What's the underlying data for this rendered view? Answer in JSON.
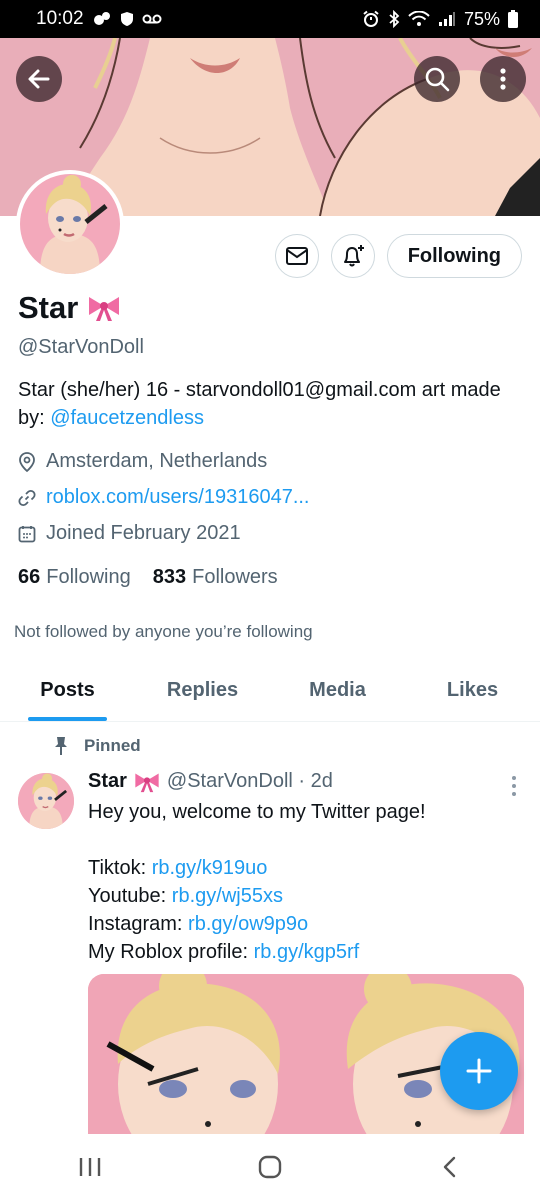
{
  "status_bar": {
    "time": "10:02",
    "battery": "75%"
  },
  "profile": {
    "name": "Star",
    "handle": "@StarVonDoll",
    "bio_text": "Star (she/her) 16 - starvondoll01@gmail.com art made by: ",
    "bio_mention": "@faucetzendless",
    "location": "Amsterdam, Netherlands",
    "website": "roblox.com/users/19316047...",
    "joined": "Joined February 2021",
    "following_count": "66",
    "following_label": "Following",
    "followers_count": "833",
    "followers_label": "Followers",
    "not_followed_text": "Not followed by anyone you’re following",
    "following_button": "Following"
  },
  "tabs": [
    {
      "label": "Posts"
    },
    {
      "label": "Replies"
    },
    {
      "label": "Media"
    },
    {
      "label": "Likes"
    }
  ],
  "post": {
    "pinned_label": "Pinned",
    "name": "Star",
    "handle_time": "@StarVonDoll · 2d",
    "line1": "Hey you, welcome to my Twitter page!",
    "tiktok_label": "Tiktok: ",
    "tiktok_link": "rb.gy/k919uo",
    "youtube_label": "Youtube: ",
    "youtube_link": "rb.gy/wj55xs",
    "instagram_label": "Instagram: ",
    "instagram_link": "rb.gy/ow9p9o",
    "roblox_label": "My Roblox profile: ",
    "roblox_link": "rb.gy/kgp5rf"
  },
  "colors": {
    "accent": "#1d9bf0",
    "secondary_text": "#536471",
    "banner_pink": "#e7a6b3"
  },
  "icons": [
    "back-arrow-icon",
    "search-icon",
    "more-vertical-icon",
    "mail-icon",
    "bell-plus-icon",
    "bow-emoji-icon",
    "location-pin-icon",
    "link-icon",
    "calendar-icon",
    "pin-icon",
    "plus-icon",
    "recent-apps-icon",
    "home-circle-icon",
    "back-chevron-icon"
  ]
}
